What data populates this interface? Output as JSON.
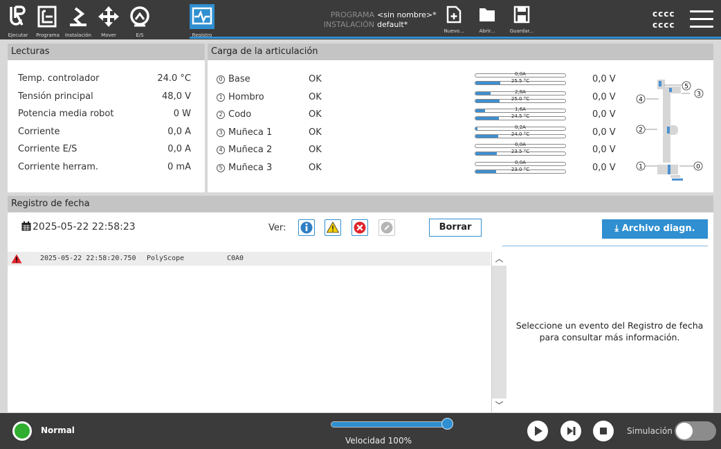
{
  "nav": {
    "items": [
      {
        "label": "Ejecutar",
        "icon": "ur-logo-icon"
      },
      {
        "label": "Programa",
        "icon": "program-icon"
      },
      {
        "label": "Instalación",
        "icon": "installation-icon"
      },
      {
        "label": "Mover",
        "icon": "move-arrows-icon"
      },
      {
        "label": "E/S",
        "icon": "io-icon"
      },
      {
        "label": "Registro",
        "icon": "log-icon",
        "active": true
      }
    ]
  },
  "program": {
    "program_key": "PROGRAMA",
    "program_value": "<sin nombre>*",
    "install_key": "INSTALACIÓN",
    "install_value": "default*"
  },
  "file": {
    "new_label": "Nuevo...",
    "open_label": "Abrir...",
    "save_label": "Guardar..."
  },
  "user": {
    "line1": "cccc",
    "line2": "cccc"
  },
  "lecturas": {
    "title": "Lecturas",
    "rows": [
      {
        "label": "Temp. controlador",
        "value": "24.0 °C"
      },
      {
        "label": "Tensión principal",
        "value": "48,0 V"
      },
      {
        "label": "Potencia media robot",
        "value": "0 W"
      },
      {
        "label": "Corriente",
        "value": "0,0 A"
      },
      {
        "label": "Corriente E/S",
        "value": "0,0 A"
      },
      {
        "label": "Corriente herram.",
        "value": "0 mA"
      }
    ]
  },
  "carga": {
    "title": "Carga de la articulación",
    "joints": [
      {
        "num": "0",
        "name": "Base",
        "status": "OK",
        "current": "0,0A",
        "current_fraction": 0.0,
        "temp": "25.5 °C",
        "temp_fraction": 0.28,
        "voltage": "0,0 V"
      },
      {
        "num": "1",
        "name": "Hombro",
        "status": "OK",
        "current": "2,8A",
        "current_fraction": 0.17,
        "temp": "25.0 °C",
        "temp_fraction": 0.27,
        "voltage": "0,0 V"
      },
      {
        "num": "2",
        "name": "Codo",
        "status": "OK",
        "current": "1,6A",
        "current_fraction": 0.11,
        "temp": "24.5 °C",
        "temp_fraction": 0.26,
        "voltage": "0,0 V"
      },
      {
        "num": "3",
        "name": "Muñeca 1",
        "status": "OK",
        "current": "0,2A",
        "current_fraction": 0.02,
        "temp": "24.0 °C",
        "temp_fraction": 0.25,
        "voltage": "0,0 V"
      },
      {
        "num": "4",
        "name": "Muñeca 2",
        "status": "OK",
        "current": "0,0A",
        "current_fraction": 0.0,
        "temp": "23.5 °C",
        "temp_fraction": 0.24,
        "voltage": "0,0 V"
      },
      {
        "num": "5",
        "name": "Muñeca 3",
        "status": "OK",
        "current": "0,0A",
        "current_fraction": 0.0,
        "temp": "23.0 °C",
        "temp_fraction": 0.23,
        "voltage": "0,0 V"
      }
    ],
    "diagram_labels": [
      "5",
      "3",
      "4",
      "2",
      "1",
      "0"
    ]
  },
  "registro": {
    "title": "Registro de fecha",
    "datetime": "2025-05-22 22:58:23",
    "ver_label": "Ver:",
    "clear_label": "Borrar",
    "diag_label": "Archivo diagn.",
    "log": [
      {
        "timestamp": "2025-05-22 22:58:20.750",
        "source": "PolyScope",
        "code": "C0A0"
      }
    ],
    "detail_message": "Seleccione un evento del Registro de fecha para consultar más información."
  },
  "status": {
    "mode": "Normal",
    "speed_label": "Velocidad 100%",
    "speed_fraction": 1.0,
    "sim_label": "Simulación"
  },
  "colors": {
    "accent": "#2f8fd0",
    "topbar": "#3b3b3b",
    "status_ok": "#2fae2f"
  }
}
